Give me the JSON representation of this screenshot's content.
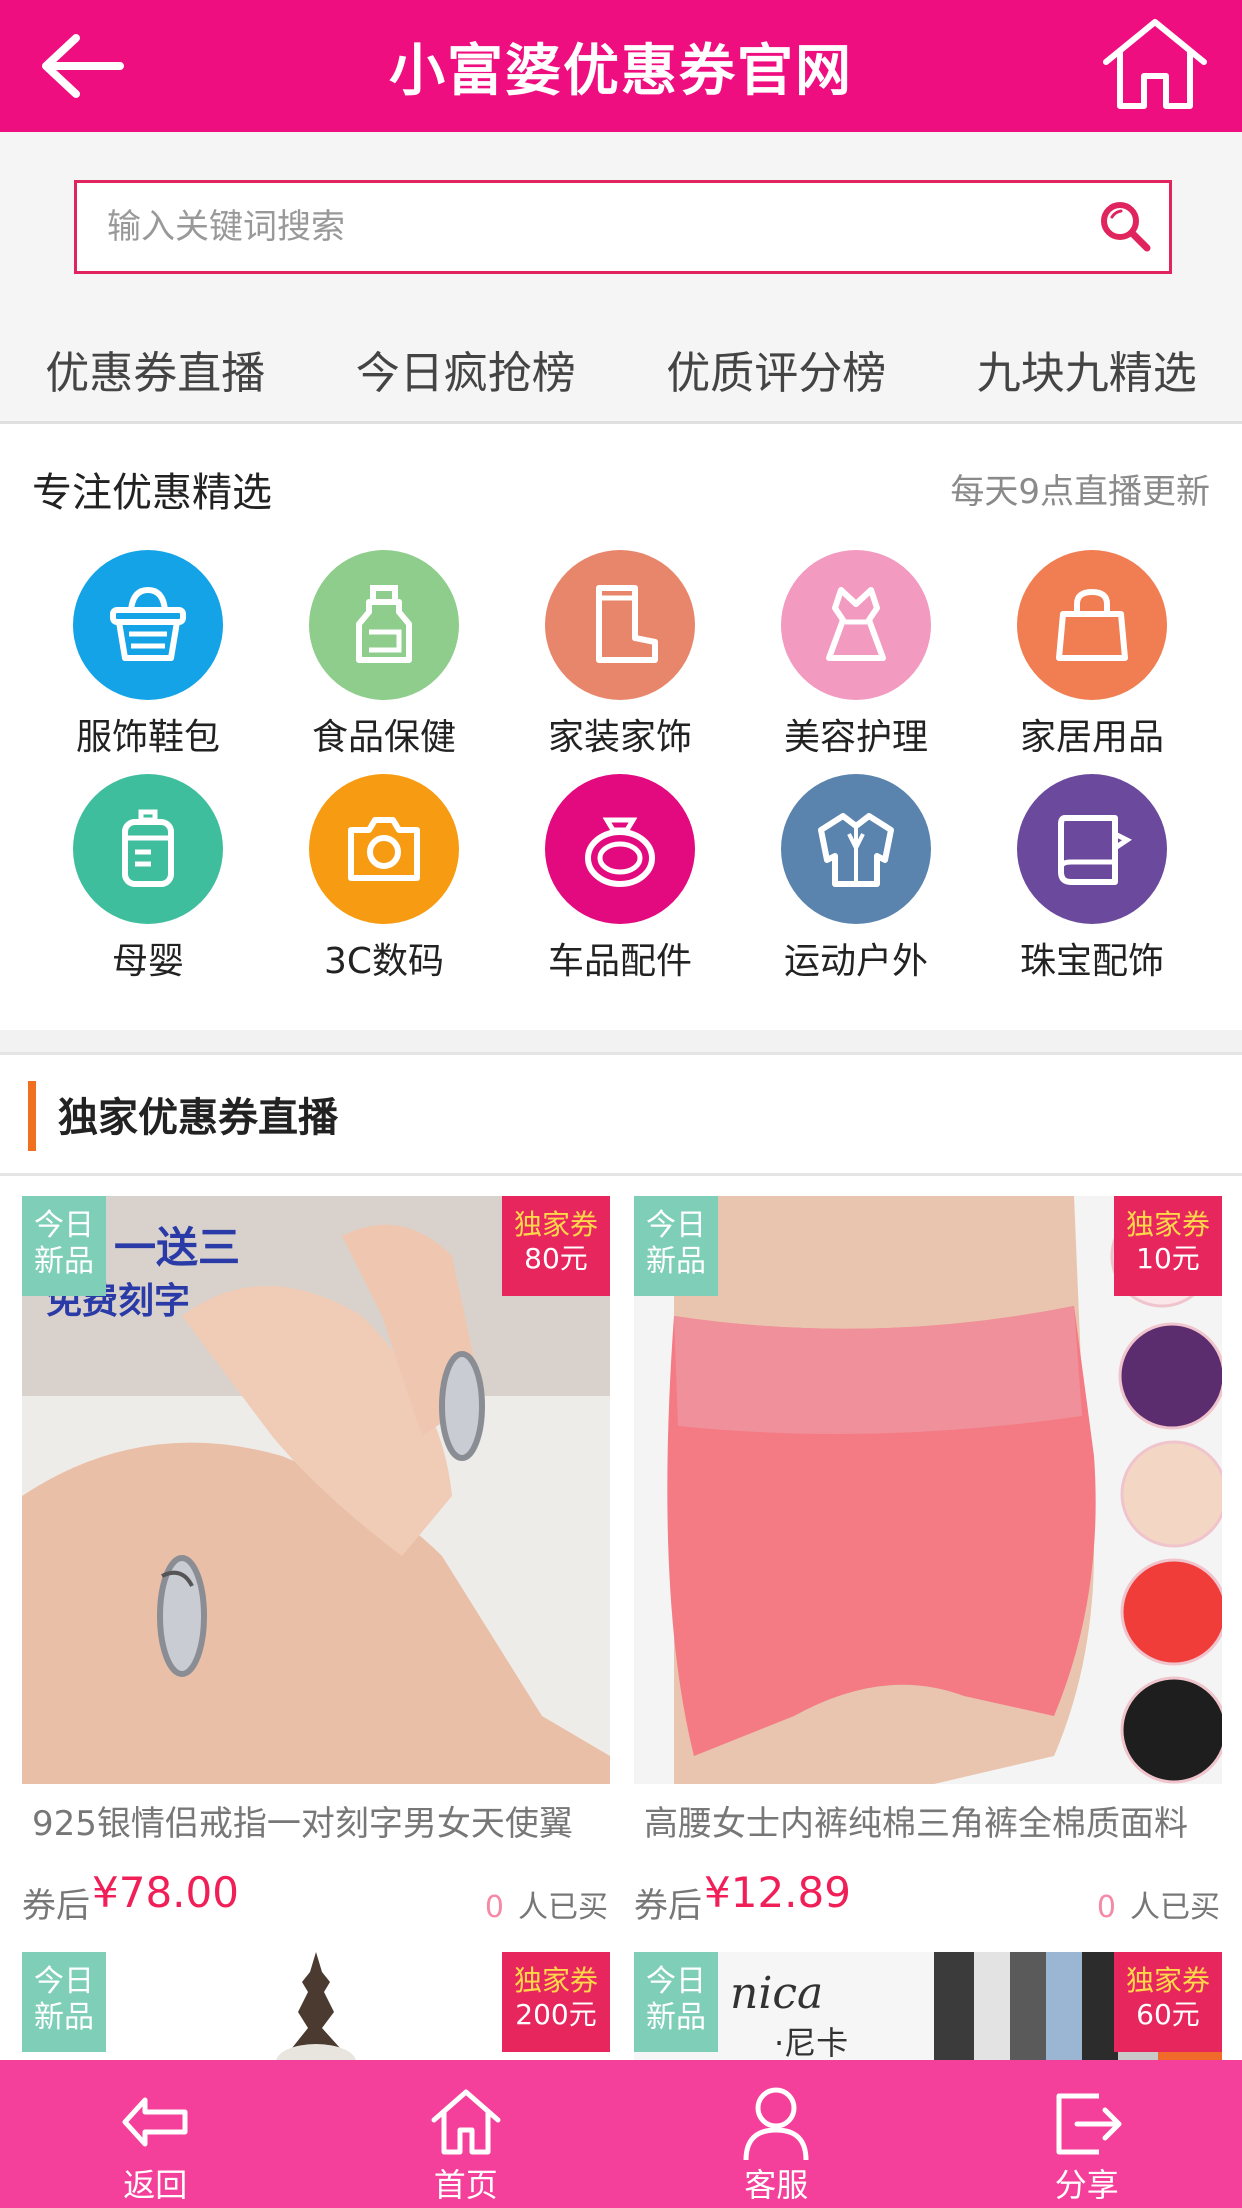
{
  "header": {
    "title": "小富婆优惠券官网"
  },
  "search": {
    "placeholder": "输入关键词搜索"
  },
  "tabs": [
    {
      "label": "优惠券直播"
    },
    {
      "label": "今日疯抢榜"
    },
    {
      "label": "优质评分榜"
    },
    {
      "label": "九块九精选"
    }
  ],
  "category": {
    "title": "专注优惠精选",
    "subtitle": "每天9点直播更新",
    "items": [
      {
        "label": "服饰鞋包",
        "icon": "basket-icon",
        "color": "#14a3e6"
      },
      {
        "label": "食品保健",
        "icon": "bottle-icon",
        "color": "#8fcd8d"
      },
      {
        "label": "家装家饰",
        "icon": "boot-icon",
        "color": "#e8866b"
      },
      {
        "label": "美容护理",
        "icon": "dress-icon",
        "color": "#f29ac0"
      },
      {
        "label": "家居用品",
        "icon": "bag-icon",
        "color": "#f07e52"
      },
      {
        "label": "母婴",
        "icon": "baby-bottle-icon",
        "color": "#3fbe9d"
      },
      {
        "label": "3C数码",
        "icon": "camera-icon",
        "color": "#f79c12"
      },
      {
        "label": "车品配件",
        "icon": "ring-icon",
        "color": "#e20a7e"
      },
      {
        "label": "运动户外",
        "icon": "jacket-icon",
        "color": "#5a84ad"
      },
      {
        "label": "珠宝配饰",
        "icon": "jewel-book-icon",
        "color": "#6b4a9e"
      }
    ]
  },
  "section": {
    "title": "独家优惠券直播"
  },
  "badges": {
    "new_line1": "今日",
    "new_line2": "新品",
    "coupon_line1": "独家券"
  },
  "products": [
    {
      "name": "925银情侣戒指一对刻字男女天使翼",
      "price_prefix": "券后",
      "price": "¥78.00",
      "buyers": "0",
      "buyers_label": "人已买",
      "coupon": "80元",
      "promo_text1": "一送三",
      "promo_text2": "免费刻字"
    },
    {
      "name": "高腰女士内裤纯棉三角裤全棉质面料",
      "price_prefix": "券后",
      "price": "¥12.89",
      "buyers": "0",
      "buyers_label": "人已买",
      "coupon": "10元"
    },
    {
      "coupon": "200元"
    },
    {
      "coupon": "60元",
      "brand_text1": "nica",
      "brand_text2": "·尼卡"
    }
  ],
  "bottom_nav": [
    {
      "label": "返回",
      "icon": "back-arrow-icon"
    },
    {
      "label": "首页",
      "icon": "home-icon"
    },
    {
      "label": "客服",
      "icon": "user-icon"
    },
    {
      "label": "分享",
      "icon": "share-icon"
    }
  ],
  "colors": {
    "brand": "#ef0e80",
    "bottom_bar": "#f4409a",
    "price": "#f01f57",
    "new_badge": "#7fcfb8",
    "coupon_badge": "#e8265e"
  }
}
